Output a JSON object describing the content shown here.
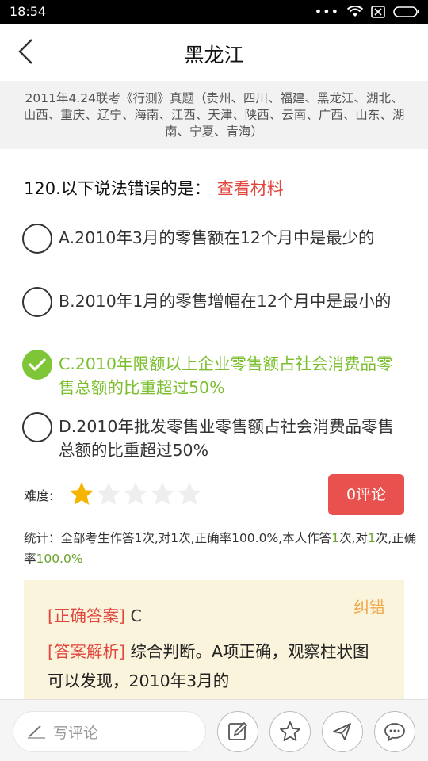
{
  "status_bar": {
    "time": "18:54",
    "dots": "•••"
  },
  "nav": {
    "title": "黑龙江"
  },
  "exam": {
    "info": "2011年4.24联考《行测》真题（贵州、四川、福建、黑龙江、湖北、山西、重庆、辽宁、海南、江西、天津、陕西、云南、广西、山东、湖南、宁夏、青海）"
  },
  "question": {
    "text": "120.以下说法错误的是：",
    "material_link": "查看材料"
  },
  "options": [
    {
      "text": "A.2010年3月的零售额在12个月中是最少的",
      "checked": false
    },
    {
      "text": "B.2010年1月的零售增幅在12个月中是最小的",
      "checked": false
    },
    {
      "text": "C.2010年限额以上企业零售额占社会消费品零售总额的比重超过50%",
      "checked": true
    },
    {
      "text": "D.2010年批发零售业零售额占社会消费品零售总额的比重超过50%",
      "checked": false
    }
  ],
  "difficulty": {
    "label": "难度:",
    "rating": 1,
    "max": 5
  },
  "comment_button": {
    "label": "0评论"
  },
  "stats": {
    "prefix": "统计：全部考生作答1次,对1次,正确率100.0%,本人作答",
    "my_attempts": "1",
    "mid": "次,对",
    "my_correct": "1",
    "mid2": "次,正确率",
    "my_rate": "100.0%"
  },
  "answer": {
    "correction": "纠错",
    "correct_label": "[正确答案]",
    "correct_value": "C",
    "analysis_label": "[答案解析]",
    "analysis_text": "综合判断。A项正确，观察柱状图可以发现，2010年3月的"
  },
  "bottom": {
    "write_placeholder": "写评论"
  },
  "colors": {
    "accent_red": "#e8514d",
    "correct_green": "#7ec638",
    "star_gold": "#f5b400",
    "correction_orange": "#f0a64a"
  }
}
